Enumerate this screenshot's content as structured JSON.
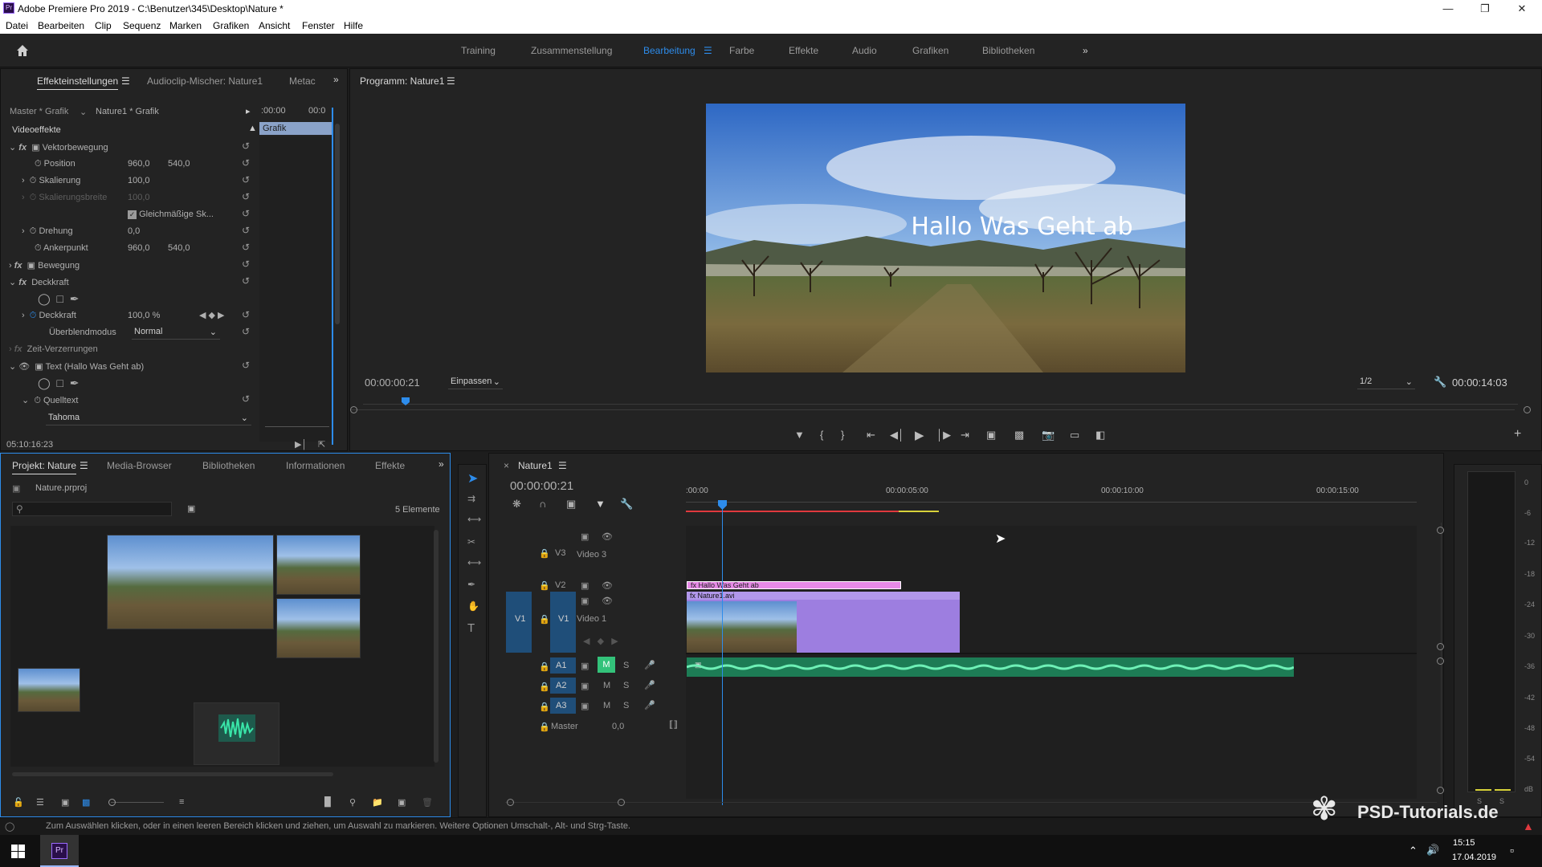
{
  "app": {
    "window_title": "Adobe Premiere Pro 2019 - C:\\Benutzer\\345\\Desktop\\Nature *",
    "app_icon_label": "Pr"
  },
  "menu": [
    "Datei",
    "Bearbeiten",
    "Clip",
    "Sequenz",
    "Marken",
    "Grafiken",
    "Ansicht",
    "Fenster",
    "Hilfe"
  ],
  "workspaces": {
    "items": [
      "Training",
      "Zusammenstellung",
      "Bearbeitung",
      "Farbe",
      "Effekte",
      "Audio",
      "Grafiken",
      "Bibliotheken"
    ],
    "active": "Bearbeitung",
    "more": "»"
  },
  "effect_controls": {
    "tabs": [
      "Effekteinstellungen",
      "Audioclip-Mischer: Nature1",
      "Metac"
    ],
    "master_label": "Master * Grafik",
    "clip_label": "Nature1 * Grafik",
    "timecode_start": ":00:00",
    "timecode_end": "00:0",
    "clip_bar_label": "Grafik",
    "section": "Videoeffekte",
    "rows": {
      "vektorbewegung": "Vektorbewegung",
      "position": "Position",
      "position_x": "960,0",
      "position_y": "540,0",
      "skalierung": "Skalierung",
      "skalierung_val": "100,0",
      "skalierungsbreite": "Skalierungsbreite",
      "skalierungsbreite_val": "100,0",
      "gleichmaessig": "Gleichmäßige Sk...",
      "drehung": "Drehung",
      "drehung_val": "0,0",
      "ankerpunkt": "Ankerpunkt",
      "anker_x": "960,0",
      "anker_y": "540,0",
      "bewegung": "Bewegung",
      "deckkraft_group": "Deckkraft",
      "deckkraft": "Deckkraft",
      "deckkraft_val": "100,0 %",
      "ueberblendmodus": "Überblendmodus",
      "blend_value": "Normal",
      "zeitverzerrung": "Zeit-Verzerrungen",
      "text_layer": "Text (Hallo Was Geht ab)",
      "quelltext": "Quelltext",
      "font": "Tahoma"
    },
    "footer_timecode": "05:10:16:23"
  },
  "program": {
    "title": "Programm: Nature1",
    "overlay_text": "Hallo Was Geht ab",
    "timecode": "00:00:00:21",
    "fit": "Einpassen",
    "resolution": "1/2",
    "duration": "00:00:14:03"
  },
  "project": {
    "tabs": [
      "Projekt: Nature",
      "Media-Browser",
      "Bibliotheken",
      "Informationen",
      "Effekte"
    ],
    "file": "Nature.prproj",
    "count": "5 Elemente",
    "search_placeholder": ""
  },
  "timeline": {
    "tab": "Nature1",
    "timecode": "00:00:00:21",
    "ruler": [
      ":00:00",
      "00:00:05:00",
      "00:00:10:00",
      "00:00:15:00"
    ],
    "tracks": {
      "v3": "V3",
      "v3_name": "Video 3",
      "v2": "V2",
      "v1": "V1",
      "v1_name": "Video 1",
      "v1_src": "V1",
      "a1": "A1",
      "a2": "A2",
      "a3": "A3",
      "m": "M",
      "s": "S",
      "master": "Master",
      "master_val": "0,0"
    },
    "clips": {
      "title_clip": "Hallo Was Geht ab",
      "video_clip": "Nature1.avi"
    }
  },
  "vu_meter": {
    "scale": [
      "0",
      "-6",
      "-12",
      "-18",
      "-24",
      "-30",
      "-36",
      "-42",
      "-48",
      "-54",
      "dB"
    ],
    "solo": [
      "S",
      "S"
    ]
  },
  "status": {
    "text": "Zum Auswählen klicken, oder in einen leeren Bereich klicken und ziehen, um Auswahl zu markieren. Weitere Optionen Umschalt-, Alt- und Strg-Taste."
  },
  "taskbar": {
    "time": "15:15",
    "date": "17.04.2019",
    "app": "Pr"
  },
  "watermark": "PSD-Tutorials.de"
}
